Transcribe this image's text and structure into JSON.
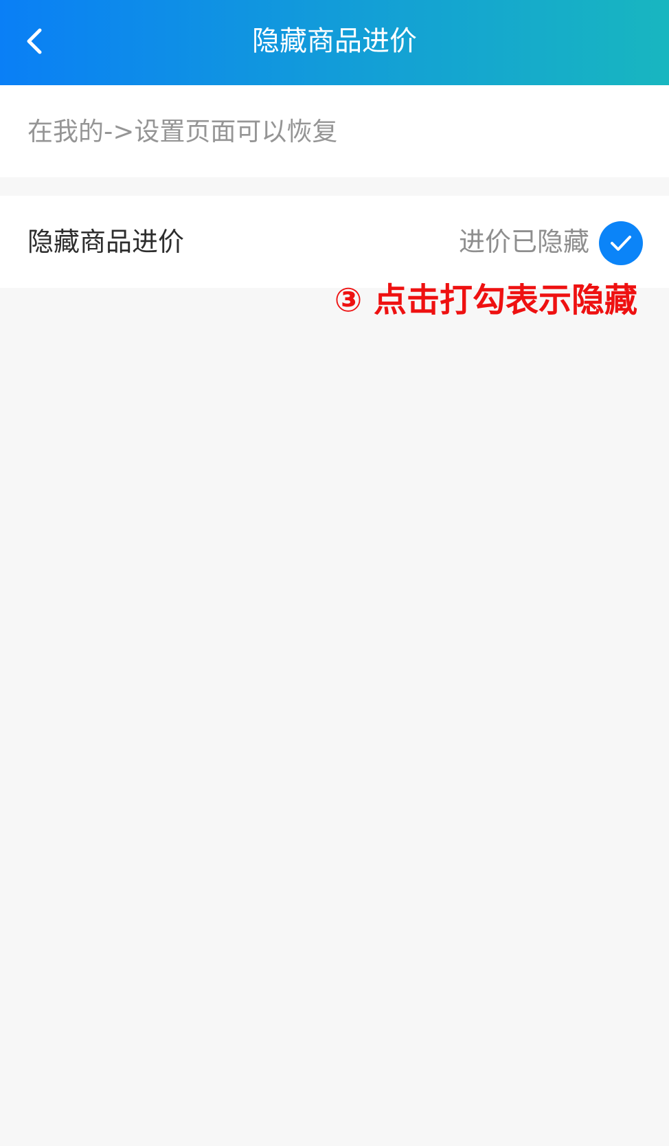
{
  "header": {
    "title": "隐藏商品进价",
    "back_icon": "chevron-left-icon",
    "gradient_start": "#0a7ff6",
    "gradient_end": "#18b6c0"
  },
  "hint": {
    "text": "在我的->设置页面可以恢复"
  },
  "setting": {
    "label": "隐藏商品进价",
    "status": "进价已隐藏",
    "checked": true,
    "check_icon": "checkmark-icon",
    "accent": "#0b84f8"
  },
  "annotation": {
    "text": "③ 点击打勾表示隐藏",
    "color": "#ee1111"
  }
}
